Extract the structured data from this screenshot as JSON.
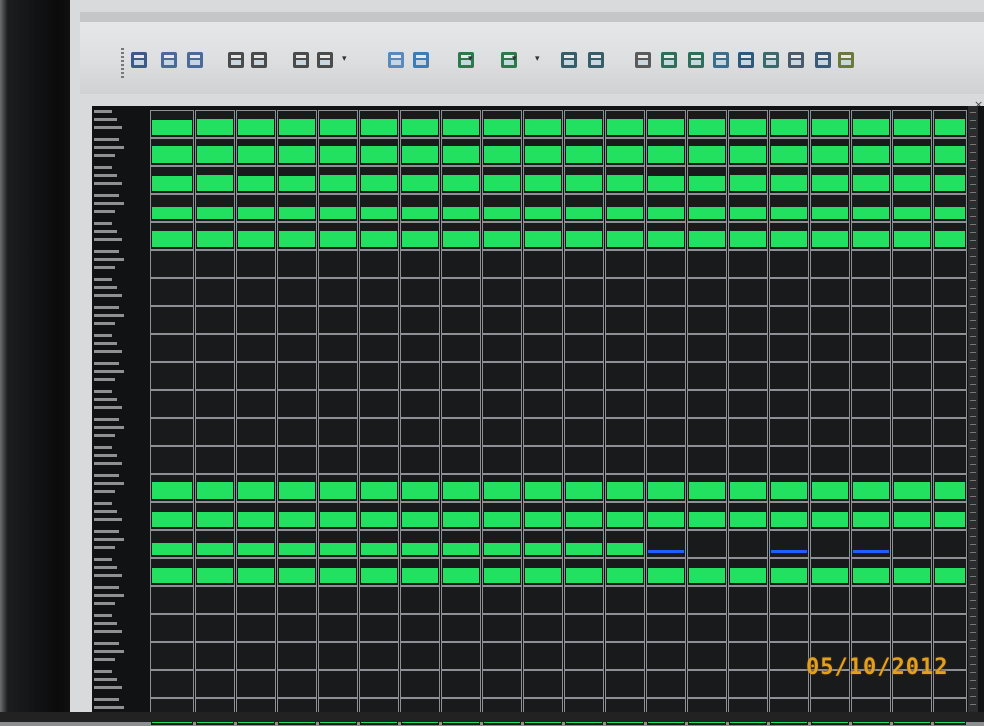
{
  "toolbar": {
    "icons": [
      "report-icon",
      "report-icon",
      "report-icon",
      "layout-icon",
      "layout-icon",
      "sum-icon",
      "window-icon",
      "globe-icon",
      "chart-icon",
      "line-chart-icon",
      "bar-chart-icon",
      "screen-icon",
      "map-icon",
      "settings-icon",
      "panel-icon",
      "panel-icon",
      "panel-icon",
      "panel-icon",
      "panel-icon",
      "panel-icon",
      "panel-icon",
      "panel-icon"
    ]
  },
  "colors": {
    "active": "#22e060",
    "alert": "#1f5fff",
    "idle": "#191a1c"
  },
  "rows": [
    {
      "state": "green",
      "levels": [
        0.7,
        0.72,
        0.72,
        0.72,
        0.72,
        0.72,
        0.72,
        0.72,
        0.72,
        0.72,
        0.72,
        0.72,
        0.72,
        0.72,
        0.72,
        0.72,
        0.72,
        0.72,
        0.72,
        0.72
      ]
    },
    {
      "state": "green",
      "levels": [
        0.78,
        0.78,
        0.78,
        0.78,
        0.78,
        0.78,
        0.78,
        0.78,
        0.78,
        0.78,
        0.78,
        0.78,
        0.78,
        0.78,
        0.78,
        0.78,
        0.78,
        0.78,
        0.78,
        0.78
      ]
    },
    {
      "state": "green",
      "levels": [
        0.7,
        0.72,
        0.7,
        0.7,
        0.72,
        0.72,
        0.72,
        0.72,
        0.72,
        0.72,
        0.72,
        0.72,
        0.7,
        0.7,
        0.72,
        0.72,
        0.72,
        0.72,
        0.72,
        0.72
      ]
    },
    {
      "state": "green",
      "levels": [
        0.55,
        0.55,
        0.55,
        0.55,
        0.55,
        0.55,
        0.55,
        0.55,
        0.55,
        0.55,
        0.55,
        0.55,
        0.55,
        0.55,
        0.55,
        0.55,
        0.55,
        0.55,
        0.55,
        0.55
      ]
    },
    {
      "state": "green",
      "levels": [
        0.72,
        0.72,
        0.72,
        0.72,
        0.72,
        0.72,
        0.72,
        0.72,
        0.72,
        0.72,
        0.72,
        0.72,
        0.72,
        0.72,
        0.72,
        0.72,
        0.72,
        0.72,
        0.72,
        0.72
      ]
    },
    {
      "state": "idle"
    },
    {
      "state": "idle"
    },
    {
      "state": "idle"
    },
    {
      "state": "idle"
    },
    {
      "state": "idle"
    },
    {
      "state": "idle"
    },
    {
      "state": "idle"
    },
    {
      "state": "idle"
    },
    {
      "state": "green",
      "levels": [
        0.75,
        0.75,
        0.75,
        0.75,
        0.75,
        0.75,
        0.75,
        0.75,
        0.75,
        0.75,
        0.75,
        0.75,
        0.75,
        0.75,
        0.75,
        0.75,
        0.75,
        0.75,
        0.75,
        0.75
      ]
    },
    {
      "state": "green",
      "levels": [
        0.7,
        0.7,
        0.7,
        0.7,
        0.7,
        0.7,
        0.7,
        0.7,
        0.7,
        0.7,
        0.7,
        0.7,
        0.7,
        0.7,
        0.7,
        0.7,
        0.7,
        0.7,
        0.7,
        0.7
      ]
    },
    {
      "state": "mixed",
      "levels": [
        0.55,
        0.55,
        0.55,
        0.55,
        0.55,
        0.55,
        0.55,
        0.55,
        0.55,
        0.55,
        0.55,
        0.55,
        0.0,
        0.0,
        0.0,
        0.0,
        0.0,
        0.0,
        0.0,
        0.0
      ],
      "blue": [
        0,
        0,
        0,
        0,
        0,
        0,
        0,
        0,
        0,
        0,
        0,
        0,
        0.15,
        0,
        0,
        0.2,
        0,
        0.15,
        0,
        0
      ]
    },
    {
      "state": "green",
      "levels": [
        0.7,
        0.7,
        0.7,
        0.7,
        0.7,
        0.7,
        0.7,
        0.7,
        0.7,
        0.7,
        0.7,
        0.7,
        0.7,
        0.7,
        0.7,
        0.7,
        0.7,
        0.7,
        0.7,
        0.7
      ]
    },
    {
      "state": "idle"
    },
    {
      "state": "idle"
    },
    {
      "state": "idle"
    },
    {
      "state": "idle"
    },
    {
      "state": "green",
      "levels": [
        0.45,
        0.45,
        0.45,
        0.45,
        0.45,
        0.45,
        0.45,
        0.45,
        0.45,
        0.45,
        0.45,
        0.45,
        0.45,
        0.45,
        0.45,
        0.45,
        0.45,
        0.45,
        0.45,
        0.45
      ]
    }
  ],
  "date_stamp": "05/10/2012"
}
